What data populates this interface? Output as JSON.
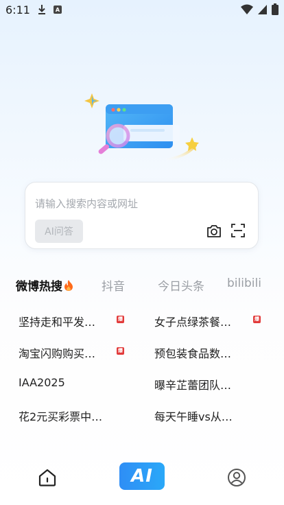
{
  "status_bar": {
    "time": "6:11",
    "notification_badge": "A",
    "icons": [
      "download-icon",
      "wifi-icon",
      "signal-icon",
      "battery-icon"
    ]
  },
  "search": {
    "placeholder": "请输入搜索内容或网址",
    "ai_chip_label": "AI问答"
  },
  "tabs": [
    {
      "label": "微博热搜",
      "active": true
    },
    {
      "label": "抖音",
      "active": false
    },
    {
      "label": "今日头条",
      "active": false
    },
    {
      "label": "bilibili",
      "active": false
    }
  ],
  "hot_list": [
    {
      "text": "坚持走和平发…",
      "badge": "爆"
    },
    {
      "text": "女子点绿茶餐…",
      "badge": "爆"
    },
    {
      "text": "淘宝闪购购买…",
      "badge": "爆"
    },
    {
      "text": "预包装食品数…",
      "badge": ""
    },
    {
      "text": "IAA2025",
      "badge": ""
    },
    {
      "text": "曝辛芷蕾团队…",
      "badge": ""
    },
    {
      "text": "花2元买彩票中…",
      "badge": ""
    },
    {
      "text": "每天午睡vs从…",
      "badge": ""
    }
  ],
  "bottom_nav": {
    "ai_label": "AI",
    "items": [
      "home-icon",
      "ai-tab",
      "user-icon"
    ]
  },
  "colors": {
    "accent": "#2f8ef5",
    "hot_badge": "#e23b3b",
    "fire": "#ff6a1a"
  }
}
